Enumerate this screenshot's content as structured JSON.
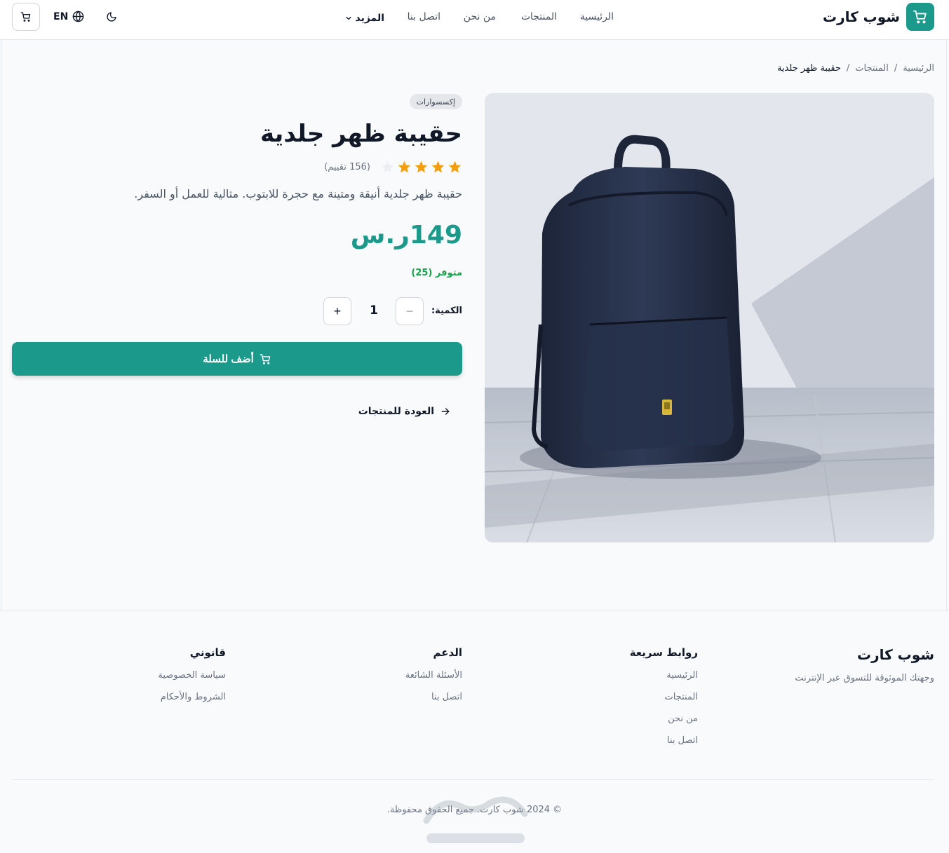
{
  "header": {
    "logo_text": "شوب كارت",
    "nav": {
      "home": "الرئيسية",
      "products": "المنتجات",
      "about": "من نحن",
      "contact": "اتصل بنا",
      "more": "المزيد"
    },
    "language": "EN"
  },
  "breadcrumb": {
    "home": "الرئيسية",
    "sep1": "/",
    "products": "المنتجات",
    "sep2": "/",
    "current": "حقيبة ظهر جلدية"
  },
  "product": {
    "category": "إكسسوارات",
    "title": "حقيبة ظهر جلدية",
    "rating": 4,
    "rating_max": 5,
    "review_count": "(156 تقييم)",
    "description": "حقيبة ظهر جلدية أنيقة ومتينة مع حجرة للابتوب. مثالية للعمل أو السفر.",
    "price": "149ر.س",
    "stock": "متوفر (25)",
    "quantity_label": "الكمية:",
    "quantity": "1",
    "minus": "−",
    "plus": "+",
    "add_to_cart": "أضف للسلة",
    "back": "العودة للمنتجات"
  },
  "footer": {
    "brand": "شوب كارت",
    "tagline": "وجهتك الموثوقة للتسوق عبر الإنترنت",
    "quick_links": {
      "heading": "روابط سريعة",
      "links": [
        "الرئيسية",
        "المنتجات",
        "من نحن",
        "اتصل بنا"
      ]
    },
    "support": {
      "heading": "الدعم",
      "links": [
        "الأسئلة الشائعة",
        "اتصل بنا"
      ]
    },
    "legal": {
      "heading": "قانوني",
      "links": [
        "سياسة الخصوصية",
        "الشروط والأحكام"
      ]
    },
    "copyright": "© 2024 شوب كارت. جميع الحقوق محفوظة."
  },
  "colors": {
    "primary": "#1b9a8c",
    "star": "#f59e0b",
    "stock": "#16a34a"
  },
  "icons": {
    "logo": "cart-icon",
    "header_cart": "cart-icon",
    "language": "globe-icon",
    "theme": "moon-icon",
    "more": "chevron-down-icon",
    "add_to_cart": "cart-icon",
    "back": "arrow-right-icon"
  }
}
